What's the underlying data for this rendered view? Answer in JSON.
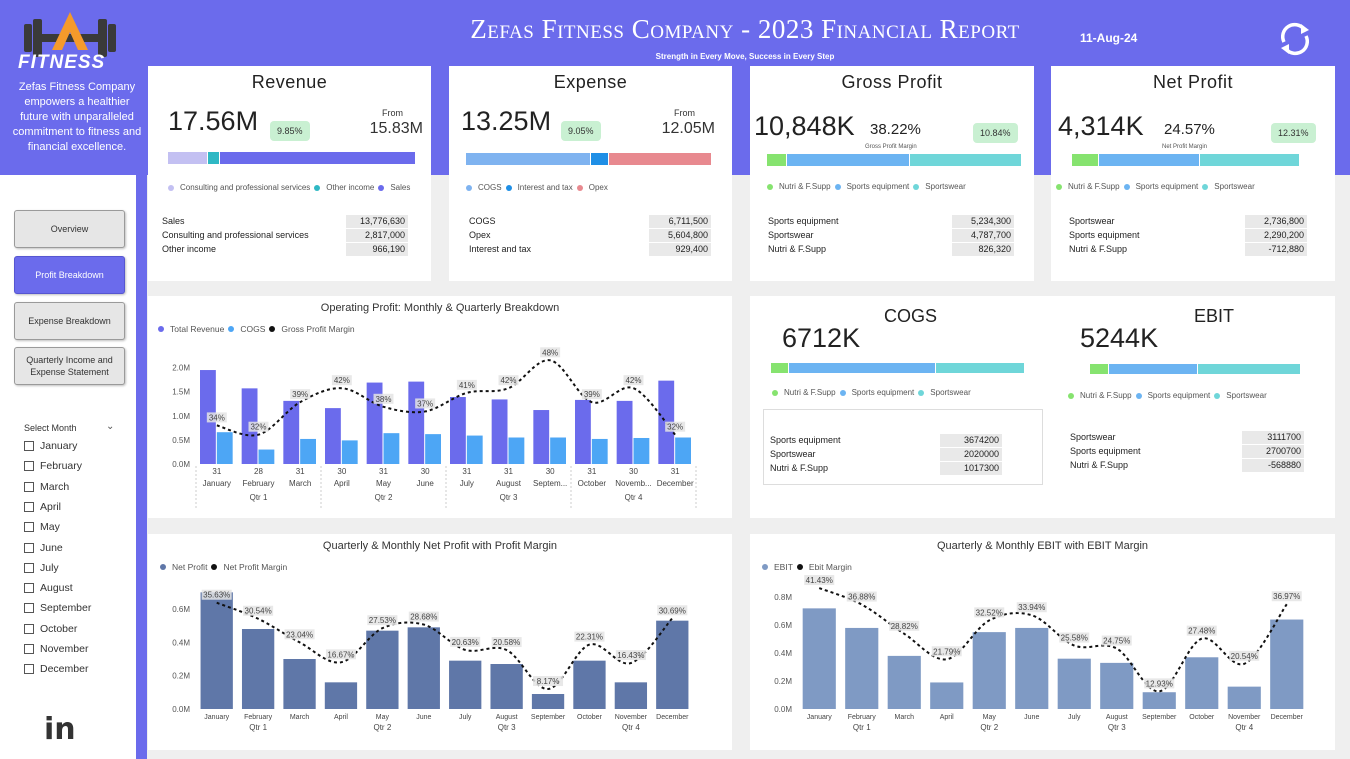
{
  "header": {
    "title": "Zefas Fitness Company - 2023 Financial Report",
    "subtitle": "Strength in Every Move, Success in Every Step",
    "date": "11-Aug-24",
    "logo_text": "FITNESS",
    "tagline": "Zefas Fitness Company empowers a healthier future with unparalleled commitment to fitness and financial excellence."
  },
  "nav": [
    {
      "label": "Overview",
      "active": false
    },
    {
      "label": "Profit Breakdown",
      "active": true
    },
    {
      "label": "Expense Breakdown",
      "active": false
    },
    {
      "label": "Quarterly Income and Expense Statement",
      "active": false
    }
  ],
  "slicer": {
    "title": "Select Month",
    "months": [
      "January",
      "February",
      "March",
      "April",
      "May",
      "June",
      "July",
      "August",
      "September",
      "October",
      "November",
      "December"
    ]
  },
  "colors": {
    "accent": "#6b6bec",
    "cogs": "#4da6f5",
    "nutri": "#86e36f",
    "sports_eq": "#6cb4f2",
    "sportswear": "#6fd6d9",
    "consulting": "#c3c0f2",
    "other": "#2fb8c4",
    "opex": "#e8898f",
    "netprofit_bar": "#5f77a8",
    "ebit_bar": "#7f9ac4"
  },
  "kpis": {
    "revenue": {
      "title": "Revenue",
      "value": "17.56M",
      "pct": "9.85%",
      "from_label": "From",
      "from_value": "15.83M",
      "legend": [
        "Consulting and professional services",
        "Other income",
        "Sales"
      ],
      "bar": [
        0.16,
        0.05,
        0.79
      ],
      "rows": [
        [
          "Sales",
          "13,776,630"
        ],
        [
          "Consulting and professional services",
          "2,817,000"
        ],
        [
          "Other income",
          "966,190"
        ]
      ]
    },
    "expense": {
      "title": "Expense",
      "value": "13.25M",
      "pct": "9.05%",
      "from_label": "From",
      "from_value": "12.05M",
      "legend": [
        "COGS",
        "Interest and tax",
        "Opex"
      ],
      "bar": [
        0.51,
        0.07,
        0.42
      ],
      "rows": [
        [
          "COGS",
          "6,711,500"
        ],
        [
          "Opex",
          "5,604,800"
        ],
        [
          "Interest and tax",
          "929,400"
        ]
      ]
    },
    "gross_profit": {
      "title": "Gross Profit",
      "value": "10,848K",
      "margin": "38.22%",
      "margin_label": "Gross Profit Margin",
      "pct": "10.84%",
      "legend": [
        "Nutri & F.Supp",
        "Sports equipment",
        "Sportswear"
      ],
      "bar": [
        0.08,
        0.48,
        0.44
      ],
      "rows": [
        [
          "Sports equipment",
          "5,234,300"
        ],
        [
          "Sportswear",
          "4,787,700"
        ],
        [
          "Nutri & F.Supp",
          "826,320"
        ]
      ]
    },
    "net_profit": {
      "title": "Net Profit",
      "value": "4,314K",
      "margin": "24.57%",
      "margin_label": "Net Profit Margin",
      "pct": "12.31%",
      "legend": [
        "Nutri & F.Supp",
        "Sports equipment",
        "Sportswear"
      ],
      "bar": [
        0.12,
        0.44,
        0.44
      ],
      "rows": [
        [
          "Sportswear",
          "2,736,800"
        ],
        [
          "Sports equipment",
          "2,290,200"
        ],
        [
          "Nutri & F.Supp",
          "-712,880"
        ]
      ]
    },
    "cogs": {
      "title": "COGS",
      "value": "6712K",
      "legend": [
        "Nutri & F.Supp",
        "Sports equipment",
        "Sportswear"
      ],
      "bar": [
        0.07,
        0.58,
        0.35
      ],
      "rows": [
        [
          "Sports equipment",
          "3674200"
        ],
        [
          "Sportswear",
          "2020000"
        ],
        [
          "Nutri & F.Supp",
          "1017300"
        ]
      ]
    },
    "ebit": {
      "title": "EBIT",
      "value": "5244K",
      "legend": [
        "Nutri & F.Supp",
        "Sports equipment",
        "Sportswear"
      ],
      "bar": [
        0.09,
        0.42,
        0.49
      ],
      "rows": [
        [
          "Sportswear",
          "3111700"
        ],
        [
          "Sports equipment",
          "2700700"
        ],
        [
          "Nutri & F.Supp",
          "-568880"
        ]
      ]
    }
  },
  "chart_data": [
    {
      "type": "bar",
      "title": "Operating Profit: Monthly & Quarterly Breakdown",
      "legend": [
        "Total Revenue",
        "COGS",
        "Gross Profit Margin"
      ],
      "categories": [
        "January",
        "February",
        "March",
        "April",
        "May",
        "June",
        "July",
        "August",
        "Septem...",
        "October",
        "Novemb...",
        "December"
      ],
      "day_labels": [
        "31",
        "28",
        "31",
        "30",
        "31",
        "30",
        "31",
        "31",
        "30",
        "31",
        "30",
        "31"
      ],
      "quarters": [
        "Qtr 1",
        "Qtr 2",
        "Qtr 3",
        "Qtr 4"
      ],
      "yticks": [
        "0.0M",
        "0.5M",
        "1.0M",
        "1.5M",
        "2.0M"
      ],
      "ylim": [
        0,
        2.2
      ],
      "series": [
        {
          "name": "Total Revenue",
          "values": [
            1.95,
            1.57,
            1.31,
            1.16,
            1.69,
            1.71,
            1.39,
            1.34,
            1.12,
            1.33,
            1.31,
            1.73
          ]
        },
        {
          "name": "COGS",
          "values": [
            0.66,
            0.3,
            0.52,
            0.49,
            0.64,
            0.62,
            0.59,
            0.55,
            0.55,
            0.52,
            0.54,
            0.55
          ]
        },
        {
          "name": "Gross Profit Margin",
          "values": [
            34,
            32,
            39,
            42,
            38,
            37,
            41,
            42,
            48,
            39,
            42,
            32
          ]
        }
      ],
      "margin_labels": [
        "34%",
        "32%",
        "39%",
        "42%",
        "38%",
        "37%",
        "41%",
        "42%",
        "48%",
        "39%",
        "42%",
        "32%"
      ]
    },
    {
      "type": "bar",
      "title": "Quarterly & Monthly Net Profit with Profit Margin",
      "legend": [
        "Net Profit",
        "Net Profit Margin"
      ],
      "categories": [
        "January",
        "February",
        "March",
        "April",
        "May",
        "June",
        "July",
        "August",
        "September",
        "October",
        "November",
        "December"
      ],
      "quarters": [
        "Qtr 1",
        "Qtr 2",
        "Qtr 3",
        "Qtr 4"
      ],
      "yticks": [
        "0.0M",
        "0.2M",
        "0.4M",
        "0.6M"
      ],
      "ylim": [
        0,
        0.72
      ],
      "series": [
        {
          "name": "Net Profit",
          "values": [
            0.7,
            0.48,
            0.3,
            0.16,
            0.47,
            0.49,
            0.29,
            0.27,
            0.09,
            0.29,
            0.16,
            0.53
          ]
        },
        {
          "name": "Net Profit Margin",
          "values": [
            35.63,
            30.54,
            23.04,
            16.67,
            27.53,
            28.68,
            20.63,
            20.58,
            8.17,
            22.31,
            16.43,
            30.69
          ]
        }
      ],
      "margin_labels": [
        "35.63%",
        "30.54%",
        "23.04%",
        "16.67%",
        "27.53%",
        "28.68%",
        "20.63%",
        "20.58%",
        "8.17%",
        "22.31%",
        "16.43%",
        "30.69%"
      ]
    },
    {
      "type": "bar",
      "title": "Quarterly & Monthly EBIT with EBIT Margin",
      "legend": [
        "EBIT",
        "Ebit Margin"
      ],
      "categories": [
        "January",
        "February",
        "March",
        "April",
        "May",
        "June",
        "July",
        "August",
        "September",
        "October",
        "November",
        "December"
      ],
      "quarters": [
        "Qtr 1",
        "Qtr 2",
        "Qtr 3",
        "Qtr 4"
      ],
      "yticks": [
        "0.0M",
        "0.2M",
        "0.4M",
        "0.6M",
        "0.8M"
      ],
      "ylim": [
        0,
        0.88
      ],
      "series": [
        {
          "name": "EBIT",
          "values": [
            0.72,
            0.58,
            0.38,
            0.19,
            0.55,
            0.58,
            0.36,
            0.33,
            0.12,
            0.37,
            0.16,
            0.64
          ]
        },
        {
          "name": "Ebit Margin",
          "values": [
            41.43,
            36.88,
            28.82,
            21.79,
            32.52,
            33.94,
            25.58,
            24.75,
            12.93,
            27.48,
            20.54,
            36.97
          ]
        }
      ],
      "margin_labels": [
        "41.43%",
        "36.88%",
        "28.82%",
        "21.79%",
        "32.52%",
        "33.94%",
        "25.58%",
        "24.75%",
        "12.93%",
        "27.48%",
        "20.54%",
        "36.97%"
      ]
    }
  ]
}
